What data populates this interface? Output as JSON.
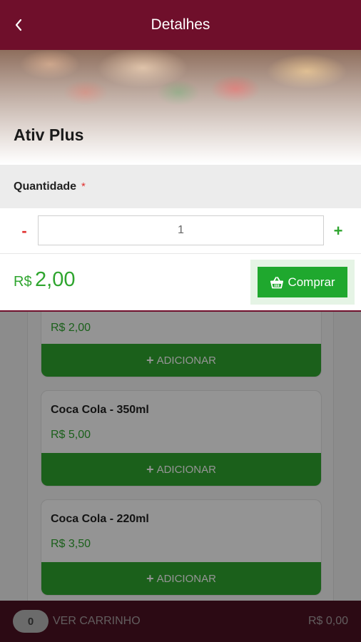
{
  "header": {
    "title": "Detalhes"
  },
  "product": {
    "name": "Ativ Plus"
  },
  "quantity": {
    "label": "Quantidade",
    "required_mark": "*",
    "minus": "-",
    "value": "1",
    "plus": "+"
  },
  "price": {
    "currency": "R$",
    "value": "2,00"
  },
  "buy_button": {
    "label": "Comprar"
  },
  "background_list": {
    "items": [
      {
        "name": "",
        "price": "R$ 2,00",
        "button": "ADICIONAR"
      },
      {
        "name": "Coca Cola - 350ml",
        "price": "R$ 5,00",
        "button": "ADICIONAR"
      },
      {
        "name": "Coca Cola - 220ml",
        "price": "R$ 3,50",
        "button": "ADICIONAR"
      }
    ]
  },
  "cart": {
    "count": "0",
    "label": "VER CARRINHO",
    "total": "R$ 0,00"
  },
  "colors": {
    "primary": "#6f0f2b",
    "accent": "#2fa52f",
    "required": "#e0302f"
  }
}
